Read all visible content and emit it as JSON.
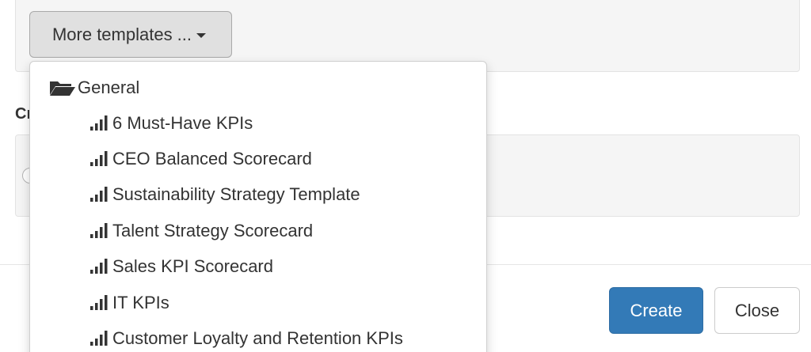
{
  "templates_button": {
    "label": "More templates ..."
  },
  "section": {
    "label_fragment": "Cr"
  },
  "dropdown": {
    "group": {
      "label": "General",
      "icon": "folder-open-icon"
    },
    "items": [
      {
        "label": "6 Must-Have KPIs",
        "icon": "signal-bars-icon"
      },
      {
        "label": "CEO Balanced Scorecard",
        "icon": "signal-bars-icon"
      },
      {
        "label": "Sustainability Strategy Template",
        "icon": "signal-bars-icon"
      },
      {
        "label": "Talent Strategy Scorecard",
        "icon": "signal-bars-icon"
      },
      {
        "label": "Sales KPI Scorecard",
        "icon": "signal-bars-icon"
      },
      {
        "label": "IT KPIs",
        "icon": "signal-bars-icon"
      },
      {
        "label": "Customer Loyalty and Retention KPIs",
        "icon": "signal-bars-icon"
      }
    ]
  },
  "footer": {
    "create_label": "Create",
    "close_label": "Close"
  },
  "colors": {
    "primary": "#337ab7",
    "well_background": "#f5f5f5",
    "button_gray": "#e0e0e0"
  }
}
